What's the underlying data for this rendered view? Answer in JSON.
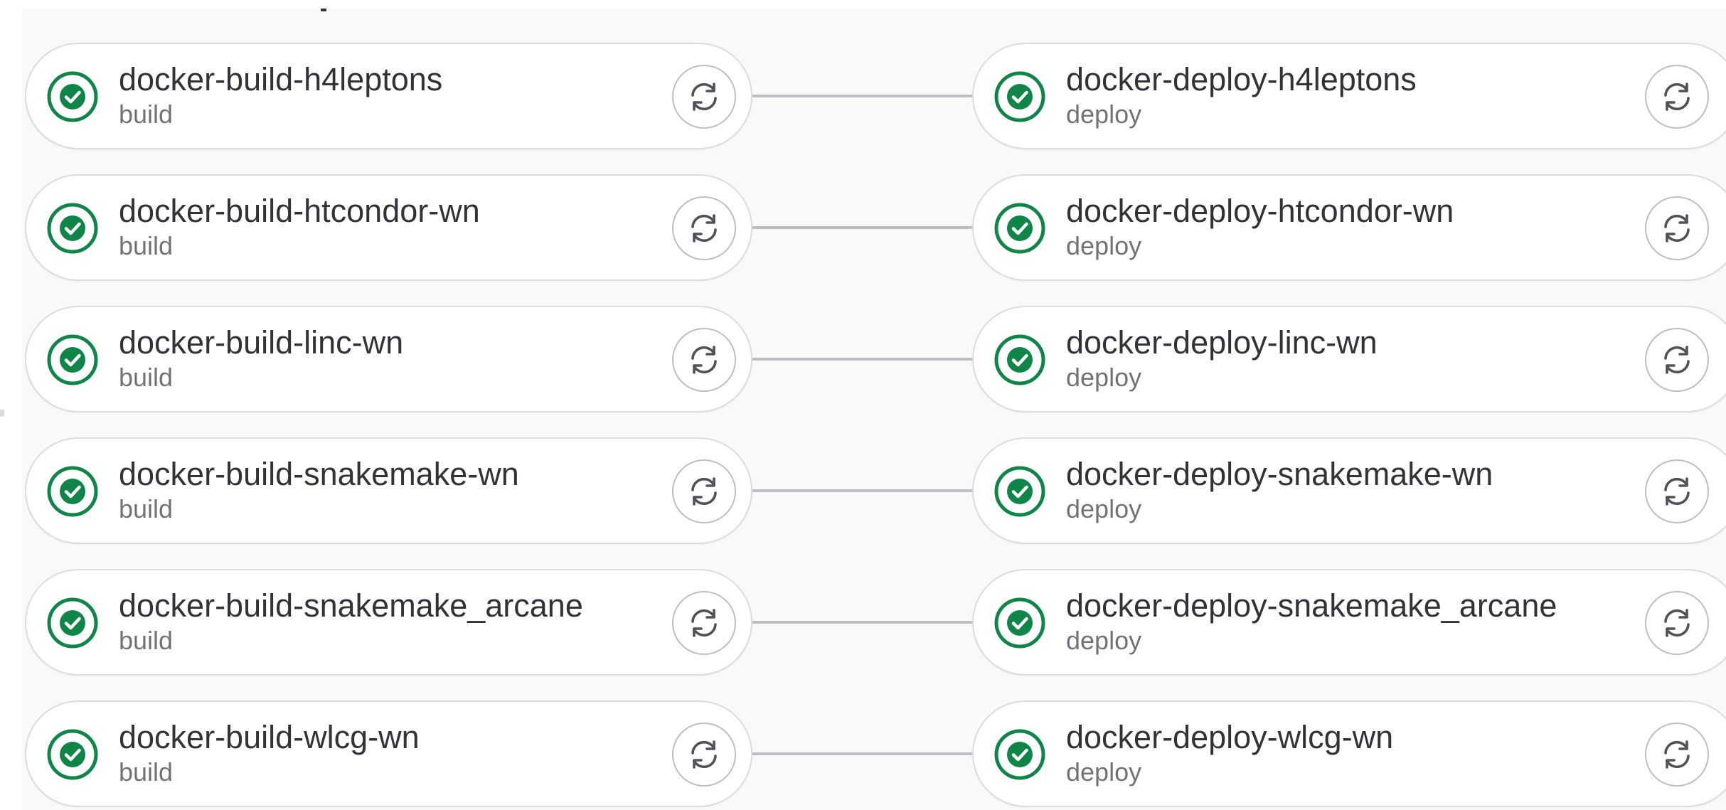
{
  "colors": {
    "success": "#108548",
    "text_primary": "#333238",
    "text_secondary": "#737278",
    "border": "#dcdcde",
    "connector": "#bfbfc3",
    "background": "#f9f9f9"
  },
  "icons": {
    "status": "status-success-icon",
    "retry": "retry-icon"
  },
  "stages": {
    "build": {
      "jobs": [
        {
          "name": "docker-build-h4leptons",
          "stage": "build",
          "status": "success"
        },
        {
          "name": "docker-build-htcondor-wn",
          "stage": "build",
          "status": "success"
        },
        {
          "name": "docker-build-linc-wn",
          "stage": "build",
          "status": "success"
        },
        {
          "name": "docker-build-snakemake-wn",
          "stage": "build",
          "status": "success"
        },
        {
          "name": "docker-build-snakemake_arcane",
          "stage": "build",
          "status": "success"
        },
        {
          "name": "docker-build-wlcg-wn",
          "stage": "build",
          "status": "success"
        }
      ]
    },
    "deploy": {
      "jobs": [
        {
          "name": "docker-deploy-h4leptons",
          "stage": "deploy",
          "status": "success"
        },
        {
          "name": "docker-deploy-htcondor-wn",
          "stage": "deploy",
          "status": "success"
        },
        {
          "name": "docker-deploy-linc-wn",
          "stage": "deploy",
          "status": "success"
        },
        {
          "name": "docker-deploy-snakemake-wn",
          "stage": "deploy",
          "status": "success"
        },
        {
          "name": "docker-deploy-snakemake_arcane",
          "stage": "deploy",
          "status": "success"
        },
        {
          "name": "docker-deploy-wlcg-wn",
          "stage": "deploy",
          "status": "success"
        }
      ]
    }
  }
}
